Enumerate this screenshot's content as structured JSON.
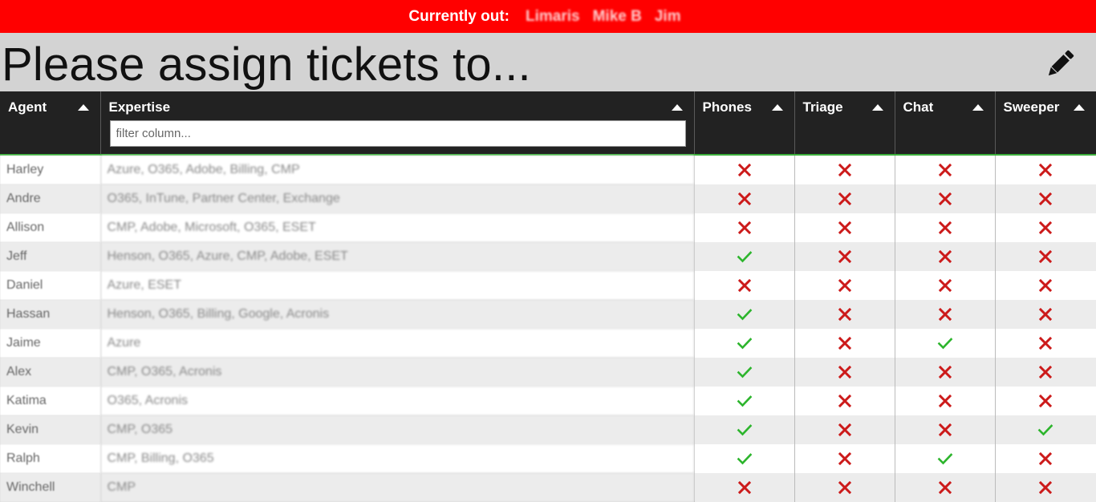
{
  "banner": {
    "label": "Currently out:",
    "names": [
      "Limaris",
      "Mike B",
      "Jim"
    ]
  },
  "page_title": "Please assign tickets to...",
  "edit_icon": "pencil-icon",
  "table": {
    "columns": [
      "Agent",
      "Expertise",
      "Phones",
      "Triage",
      "Chat",
      "Sweeper"
    ],
    "filter_placeholder": "filter column...",
    "rows": [
      {
        "agent": "Harley",
        "expertise": "Azure, O365, Adobe, Billing, CMP",
        "phones": false,
        "triage": false,
        "chat": false,
        "sweeper": false
      },
      {
        "agent": "Andre",
        "expertise": "O365, InTune, Partner Center, Exchange",
        "phones": false,
        "triage": false,
        "chat": false,
        "sweeper": false
      },
      {
        "agent": "Allison",
        "expertise": "CMP, Adobe, Microsoft, O365, ESET",
        "phones": false,
        "triage": false,
        "chat": false,
        "sweeper": false
      },
      {
        "agent": "Jeff",
        "expertise": "Henson, O365, Azure, CMP, Adobe, ESET",
        "phones": true,
        "triage": false,
        "chat": false,
        "sweeper": false
      },
      {
        "agent": "Daniel",
        "expertise": "Azure, ESET",
        "phones": false,
        "triage": false,
        "chat": false,
        "sweeper": false
      },
      {
        "agent": "Hassan",
        "expertise": "Henson, O365, Billing, Google, Acronis",
        "phones": true,
        "triage": false,
        "chat": false,
        "sweeper": false
      },
      {
        "agent": "Jaime",
        "expertise": "Azure",
        "phones": true,
        "triage": false,
        "chat": true,
        "sweeper": false
      },
      {
        "agent": "Alex",
        "expertise": "CMP, O365, Acronis",
        "phones": true,
        "triage": false,
        "chat": false,
        "sweeper": false
      },
      {
        "agent": "Katima",
        "expertise": "O365, Acronis",
        "phones": true,
        "triage": false,
        "chat": false,
        "sweeper": false
      },
      {
        "agent": "Kevin",
        "expertise": "CMP, O365",
        "phones": true,
        "triage": false,
        "chat": false,
        "sweeper": true
      },
      {
        "agent": "Ralph",
        "expertise": "CMP, Billing, O365",
        "phones": true,
        "triage": false,
        "chat": true,
        "sweeper": false
      },
      {
        "agent": "Winchell",
        "expertise": "CMP",
        "phones": false,
        "triage": false,
        "chat": false,
        "sweeper": false
      }
    ]
  },
  "icons": {
    "yes": "check-icon",
    "no": "x-icon",
    "sort": "sort-up-icon"
  },
  "colors": {
    "banner": "#ff0000",
    "check": "#2db52d",
    "cross": "#cc1a1a",
    "header": "#222222",
    "header_rule": "#3cae3c"
  }
}
